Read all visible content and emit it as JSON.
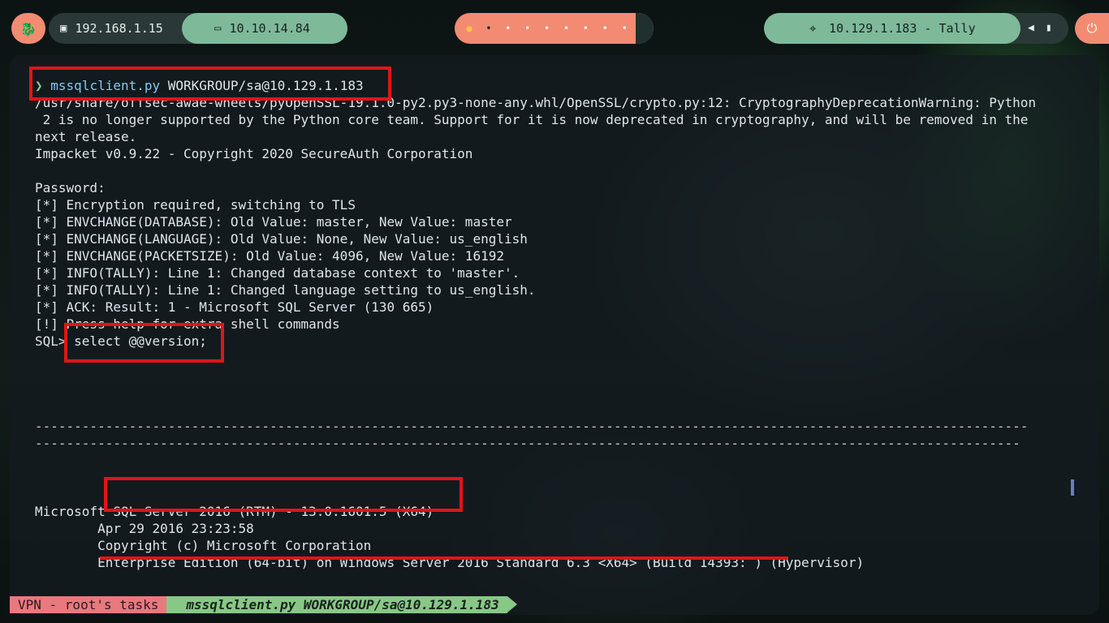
{
  "topbar": {
    "launcher_icon": "kali-dragon-icon",
    "local_ip": "192.168.1.15",
    "vpn_ip": "10.10.14.84",
    "workspaces": [
      "●",
      "•",
      "•",
      "•",
      "•",
      "•",
      "•",
      "•",
      "•",
      "•"
    ],
    "target": "10.129.1.183 - Tally",
    "tray_icons": [
      "volume-icon",
      "battery-icon"
    ],
    "power_icon": "power-icon"
  },
  "terminal": {
    "prompt_symbol": "❯",
    "command_name": "mssqlclient.py",
    "command_args": " WORKGROUP/sa@10.129.1.183",
    "lines": [
      "/usr/share/offsec-awae-wheels/pyOpenSSL-19.1.0-py2.py3-none-any.whl/OpenSSL/crypto.py:12: CryptographyDeprecationWarning: Python",
      " 2 is no longer supported by the Python core team. Support for it is now deprecated in cryptography, and will be removed in the",
      "next release.",
      "Impacket v0.9.22 - Copyright 2020 SecureAuth Corporation",
      "",
      "Password:",
      "[*] Encryption required, switching to TLS",
      "[*] ENVCHANGE(DATABASE): Old Value: master, New Value: master",
      "[*] ENVCHANGE(LANGUAGE): Old Value: None, New Value: us_english",
      "[*] ENVCHANGE(PACKETSIZE): Old Value: 4096, New Value: 16192",
      "[*] INFO(TALLY): Line 1: Changed database context to 'master'.",
      "[*] INFO(TALLY): Line 1: Changed language setting to us_english.",
      "[*] ACK: Result: 1 - Microsoft SQL Server (130 665)",
      "[!] Press help for extra shell commands",
      "SQL> select @@version;",
      "",
      "",
      "",
      "",
      "-------------------------------------------------------------------------------------------------------------------------------",
      "------------------------------------------------------------------------------------------------------------------------------",
      "",
      "",
      "",
      "Microsoft SQL Server 2016 (RTM) - 13.0.1601.5 (X64)",
      "        Apr 29 2016 23:23:58",
      "        Copyright (c) Microsoft Corporation",
      "        Enterprise Edition (64-bit) on Windows Server 2016 Standard 6.3 <X64> (Build 14393: ) (Hypervisor)"
    ]
  },
  "statusline": {
    "left": "VPN - root's tasks",
    "right": "mssqlclient.py WORKGROUP/sa@10.129.1.183"
  },
  "colors": {
    "accent_orange": "#f28b72",
    "accent_green": "#7eb99a",
    "highlight_red": "#e01515"
  }
}
